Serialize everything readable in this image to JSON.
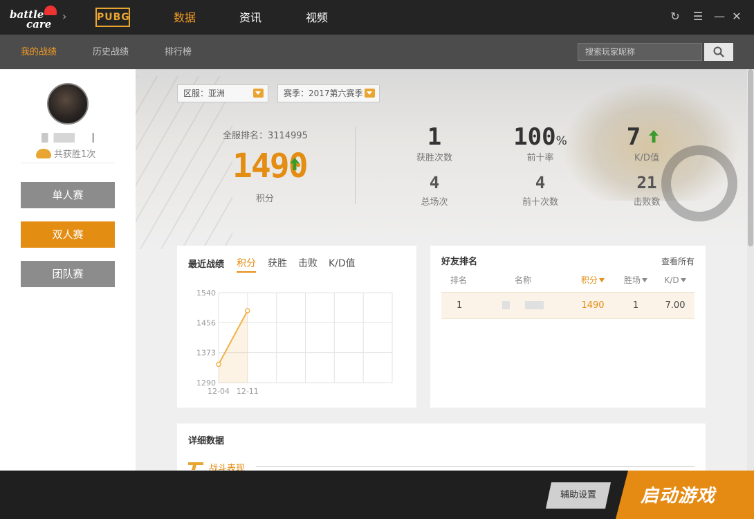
{
  "app": {
    "logo_line1": "battle",
    "logo_line2": "care",
    "game_logo": "PUBG"
  },
  "top_nav": [
    {
      "label": "数据",
      "active": true
    },
    {
      "label": "资讯",
      "active": false
    },
    {
      "label": "视频",
      "active": false
    }
  ],
  "window_controls": [
    "refresh-icon",
    "menu-icon",
    "minimize-icon",
    "close-icon"
  ],
  "sub_nav": [
    {
      "label": "我的战绩",
      "active": true
    },
    {
      "label": "历史战绩",
      "active": false
    },
    {
      "label": "排行榜",
      "active": false
    }
  ],
  "search": {
    "placeholder": "搜索玩家昵称"
  },
  "profile": {
    "wins_text": "共获胜1次"
  },
  "modes": [
    {
      "label": "单人赛",
      "active": false
    },
    {
      "label": "双人赛",
      "active": true
    },
    {
      "label": "团队赛",
      "active": false
    }
  ],
  "filters": {
    "region": "区服：亚洲",
    "season": "赛季：2017第六赛季"
  },
  "summary": {
    "rank_label": "全服排名：3114995",
    "score": "1490",
    "score_label": "积分"
  },
  "stats": {
    "wins": {
      "value": "1",
      "label": "获胜次数"
    },
    "top10_rate": {
      "value": "100",
      "unit": "%",
      "label": "前十率"
    },
    "kd": {
      "value": "7",
      "label": "K/D值"
    },
    "matches": {
      "value": "4",
      "label": "总场次"
    },
    "top10_count": {
      "value": "4",
      "label": "前十次数"
    },
    "kills": {
      "value": "21",
      "label": "击败数"
    }
  },
  "recent": {
    "title": "最近战绩",
    "tabs": [
      {
        "label": "积分",
        "active": true
      },
      {
        "label": "获胜",
        "active": false
      },
      {
        "label": "击败",
        "active": false
      },
      {
        "label": "K/D值",
        "active": false
      }
    ]
  },
  "chart_data": {
    "type": "area",
    "x": [
      "12-04",
      "12-11"
    ],
    "values": [
      1341,
      1490
    ],
    "yticks": [
      "1540",
      "1456",
      "1373",
      "1290"
    ],
    "ylim": [
      1290,
      1540
    ],
    "grid": true,
    "color": "#f0b048"
  },
  "friends": {
    "title": "好友排名",
    "view_all": "查看所有",
    "columns": [
      "排名",
      "名称",
      "积分",
      "胜场",
      "K/D"
    ],
    "rows": [
      {
        "rank": "1",
        "name": "",
        "score": "1490",
        "wins": "1",
        "kd": "7.00"
      }
    ]
  },
  "details": {
    "title": "详细数据",
    "section_combat": "战斗表现"
  },
  "bottom": {
    "assist": "辅助设置",
    "launch": "启动游戏"
  },
  "colors": {
    "accent": "#e48d13",
    "topbar": "#242424",
    "subbar": "#4c4c4c",
    "up_arrow": "#3a9a2c"
  }
}
